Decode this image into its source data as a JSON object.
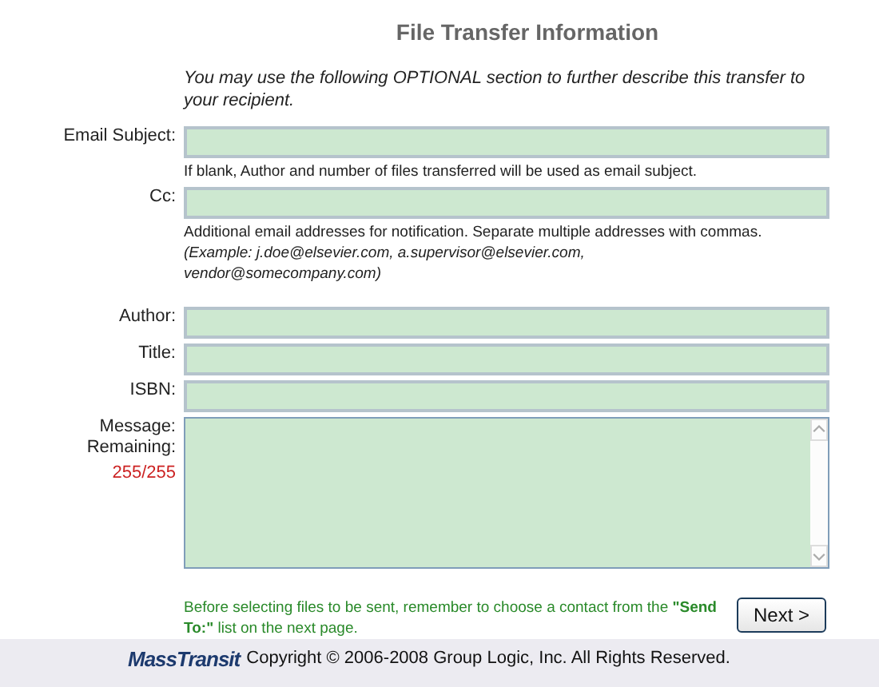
{
  "heading": "File Transfer Information",
  "intro": "You may use the following OPTIONAL section to further describe this transfer to your recipient.",
  "fields": [
    {
      "kind": "input",
      "label": "Email Subject:",
      "help": "If blank, Author and number of files transferred will be used as email subject."
    },
    {
      "kind": "input",
      "label": "Cc:",
      "help": "Additional email addresses for notification. Separate multiple addresses with commas. *(Example: j.doe@elsevier.com, a.supervisor@elsevier.com, vendor@somecompany.com)*"
    },
    {
      "kind": "input",
      "label": "Author:"
    },
    {
      "kind": "input",
      "label": "Title:"
    },
    {
      "kind": "input",
      "label": "ISBN:"
    },
    {
      "kind": "textarea",
      "label": "Message:",
      "sublabel": "Remaining:",
      "counter": "255/255"
    }
  ],
  "note": "Before selecting files to be sent, remember to choose a contact from the **\"Send To:\"** list on the next page.",
  "next_button": "Next >",
  "footer": {
    "logo": "MassTransit",
    "copyright": "Copyright © 2006-2008 Group Logic, Inc. All Rights Reserved."
  }
}
